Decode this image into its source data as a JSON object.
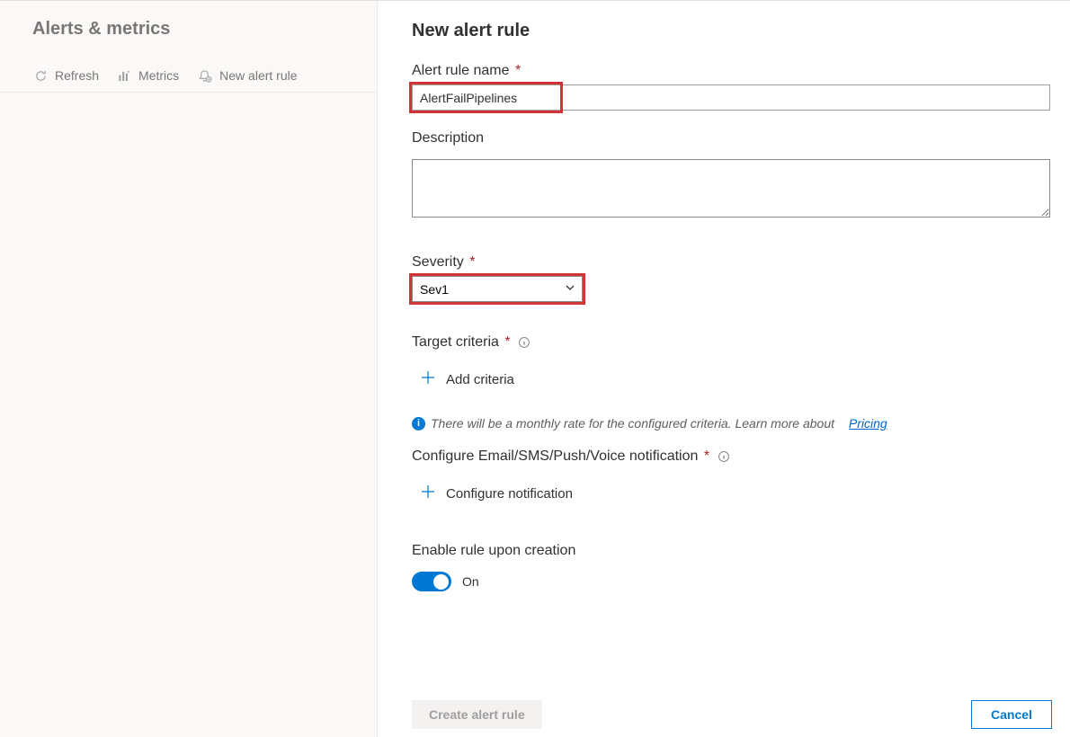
{
  "sidebar": {
    "title": "Alerts & metrics",
    "items": [
      {
        "label": "Refresh"
      },
      {
        "label": "Metrics"
      },
      {
        "label": "New alert rule"
      }
    ]
  },
  "page": {
    "title": "New alert rule",
    "alert_name_label": "Alert rule name",
    "alert_name_value": "AlertFailPipelines",
    "description_label": "Description",
    "description_value": "",
    "severity_label": "Severity",
    "severity_value": "Sev1",
    "target_criteria_label": "Target criteria",
    "add_criteria_label": "Add criteria",
    "info_text": "There will be a monthly rate for the configured criteria. Learn more about",
    "pricing_link": "Pricing",
    "configure_notif_label": "Configure Email/SMS/Push/Voice notification",
    "configure_notif_button": "Configure notification",
    "enable_rule_label": "Enable rule upon creation",
    "toggle_state": "On",
    "create_button": "Create alert rule",
    "cancel_button": "Cancel"
  },
  "colors": {
    "accent": "#0078d4",
    "error": "#a4262c",
    "highlight": "#d13438"
  }
}
